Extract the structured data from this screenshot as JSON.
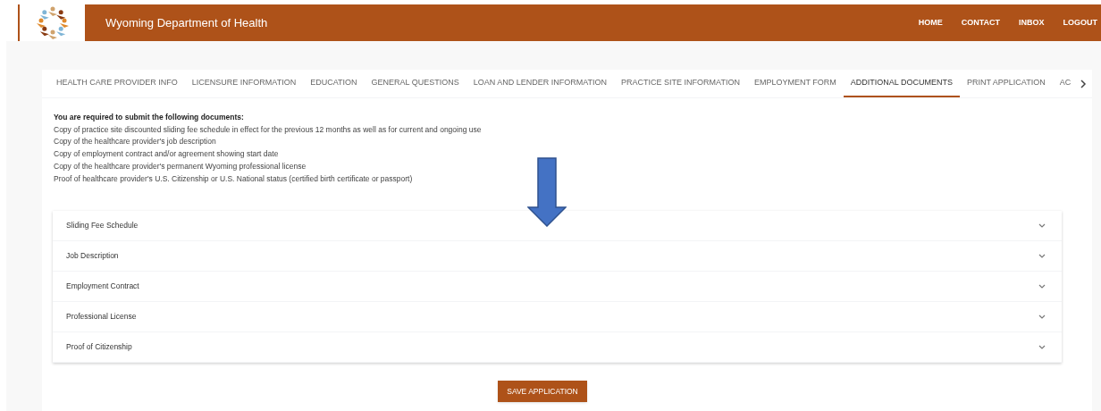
{
  "header": {
    "title": "Wyoming Department of Health",
    "nav": [
      "HOME",
      "CONTACT",
      "INBOX",
      "LOGOUT"
    ]
  },
  "tabs": [
    {
      "label": "HEALTH CARE PROVIDER INFO",
      "selected": false
    },
    {
      "label": "LICENSURE INFORMATION",
      "selected": false
    },
    {
      "label": "EDUCATION",
      "selected": false
    },
    {
      "label": "GENERAL QUESTIONS",
      "selected": false
    },
    {
      "label": "LOAN AND LENDER INFORMATION",
      "selected": false
    },
    {
      "label": "PRACTICE SITE INFORMATION",
      "selected": false
    },
    {
      "label": "EMPLOYMENT FORM",
      "selected": false
    },
    {
      "label": "ADDITIONAL DOCUMENTS",
      "selected": true
    },
    {
      "label": "PRINT APPLICATION",
      "selected": false
    },
    {
      "label": "AC",
      "selected": false
    }
  ],
  "instructions": {
    "heading": "You are required to submit the following documents:",
    "items": [
      "Copy of practice site discounted sliding fee schedule in effect for the previous 12 months as well as for current and ongoing use",
      "Copy of the healthcare provider's job description",
      "Copy of employment contract and/or agreement showing start date",
      "Copy of the healthcare provider's permanent Wyoming professional license",
      "Proof of healthcare provider's U.S. Citizenship or U.S. National status (certified birth certificate or passport)"
    ]
  },
  "accordion": [
    {
      "label": "Sliding Fee Schedule",
      "expanded": false
    },
    {
      "label": "Job Description",
      "expanded": false
    },
    {
      "label": "Employment Contract",
      "expanded": false
    },
    {
      "label": "Professional License",
      "expanded": false
    },
    {
      "label": "Proof of Citizenship",
      "expanded": false
    }
  ],
  "save_button": "SAVE APPLICATION"
}
